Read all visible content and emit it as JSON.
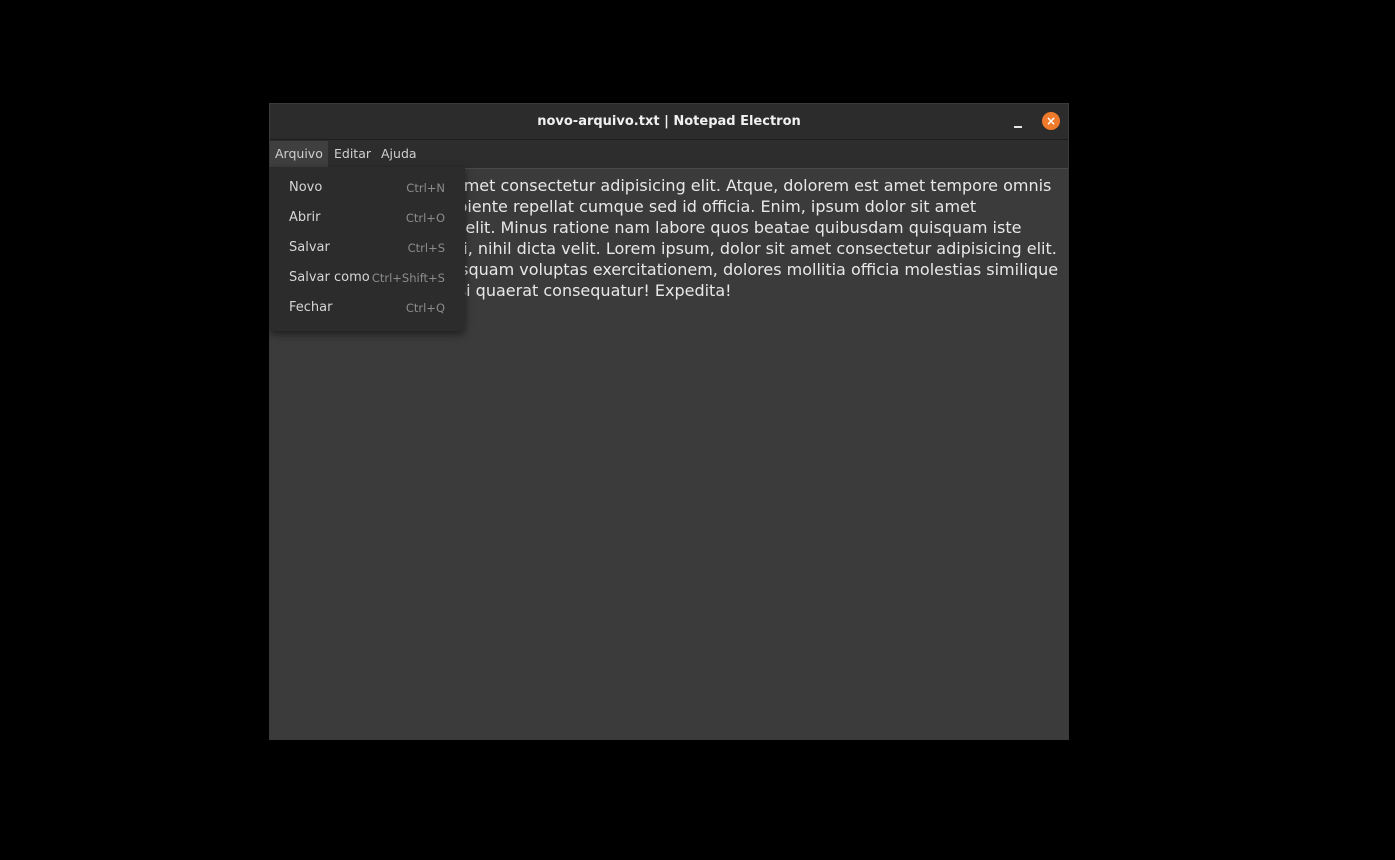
{
  "window": {
    "title": "novo-arquivo.txt | Notepad Electron",
    "minimize_icon": "minimize-icon",
    "close_icon": "close-icon",
    "close_color": "#ef7a2c"
  },
  "menubar": {
    "items": [
      {
        "label": "Arquivo"
      },
      {
        "label": "Editar"
      },
      {
        "label": "Ajuda"
      }
    ]
  },
  "file_menu": {
    "items": [
      {
        "label": "Novo",
        "shortcut": "Ctrl+N"
      },
      {
        "label": "Abrir",
        "shortcut": "Ctrl+O"
      },
      {
        "label": "Salvar",
        "shortcut": "Ctrl+S"
      },
      {
        "label": "Salvar como",
        "shortcut": "Ctrl+Shift+S"
      },
      {
        "label": "Fechar",
        "shortcut": "Ctrl+Q"
      }
    ]
  },
  "editor": {
    "content": "Lorem ipsum dolor sit amet consectetur adipisicing elit. Atque, dolorem est amet tempore omnis dicta! Non, ullam ut sapiente repellat cumque sed id officia. Enim, ipsum dolor sit amet consectetur adipisicing elit. Minus ratione nam labore quos beatae quibusdam quisquam iste laborum aliquid corrupti, nihil dicta velit. Lorem ipsum, dolor sit amet consectetur adipisicing elit. lorem sit, possimus quisquam voluptas exercitationem, dolores mollitia officia molestias similique repudiandae, harum nisi quaerat consequatur! Expedita!"
  }
}
